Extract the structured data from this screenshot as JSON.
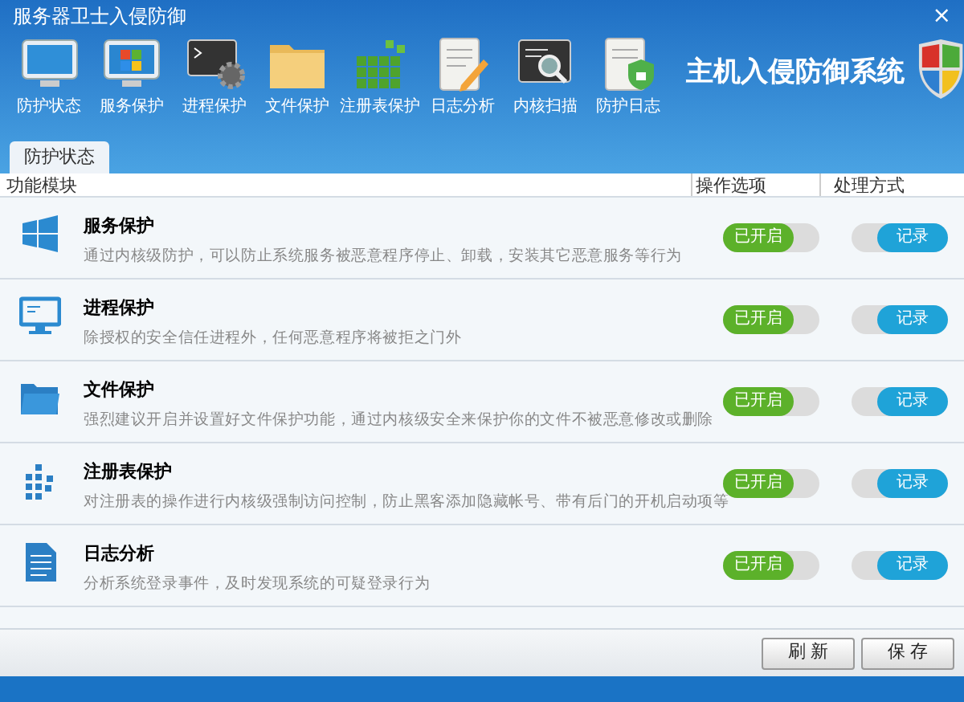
{
  "window": {
    "title": "服务器卫士入侵防御",
    "close": "×"
  },
  "toolbar": [
    {
      "label": "防护状态",
      "kind": "monitor"
    },
    {
      "label": "服务保护",
      "kind": "windows"
    },
    {
      "label": "进程保护",
      "kind": "terminal"
    },
    {
      "label": "文件保护",
      "kind": "folder"
    },
    {
      "label": "注册表保护",
      "kind": "cubes"
    },
    {
      "label": "日志分析",
      "kind": "notepad"
    },
    {
      "label": "内核扫描",
      "kind": "scan"
    },
    {
      "label": "防护日志",
      "kind": "lock"
    }
  ],
  "brand": "主机入侵防御系统",
  "tabs": [
    {
      "label": "防护状态",
      "selected": true
    }
  ],
  "table": {
    "columns": [
      "功能模块",
      "操作选项",
      "处理方式"
    ],
    "rows": [
      {
        "kind": "windows",
        "title": "服务保护",
        "description": "通过内核级防护，可以防止系统服务被恶意程序停止、卸载，安装其它恶意服务等行为",
        "option": {
          "label": "已开启",
          "on": true
        },
        "mode": {
          "label": "记录",
          "on": true
        }
      },
      {
        "kind": "monitor",
        "title": "进程保护",
        "description": "除授权的安全信任进程外，任何恶意程序将被拒之门外",
        "option": {
          "label": "已开启",
          "on": true
        },
        "mode": {
          "label": "记录",
          "on": true
        }
      },
      {
        "kind": "folder",
        "title": "文件保护",
        "description": "强烈建议开启并设置好文件保护功能，通过内核级安全来保护你的文件不被恶意修改或删除",
        "option": {
          "label": "已开启",
          "on": true
        },
        "mode": {
          "label": "记录",
          "on": true
        }
      },
      {
        "kind": "grid",
        "title": "注册表保护",
        "description": "对注册表的操作进行内核级强制访问控制，防止黑客添加隐藏帐号、带有后门的开机启动项等",
        "option": {
          "label": "已开启",
          "on": true
        },
        "mode": {
          "label": "记录",
          "on": true
        }
      },
      {
        "kind": "document",
        "title": "日志分析",
        "description": "分析系统登录事件，及时发现系统的可疑登录行为",
        "option": {
          "label": "已开启",
          "on": true
        },
        "mode": {
          "label": "记录",
          "on": true
        }
      }
    ]
  },
  "buttons": [
    "刷 新",
    "保 存"
  ]
}
